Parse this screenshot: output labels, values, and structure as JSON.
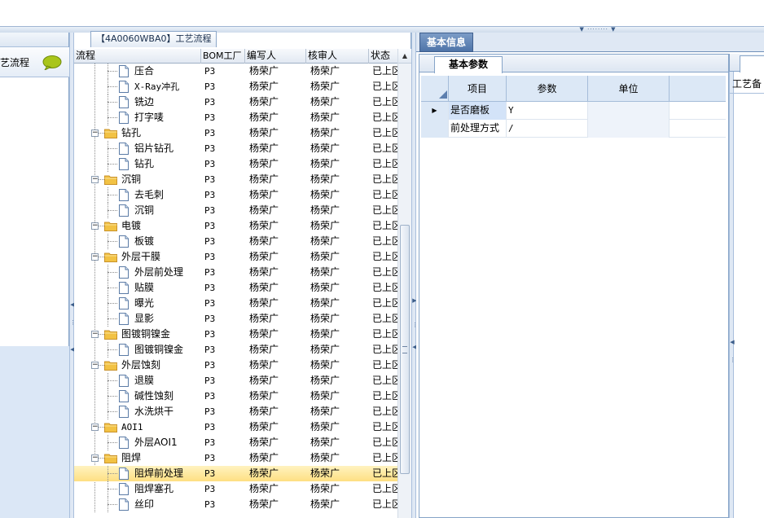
{
  "left_panel": {
    "tab_label": "艺流程"
  },
  "tree_panel": {
    "tab_title": "【4A0060WBA0】工艺流程",
    "columns": [
      "流程",
      "BOM工厂",
      "编写人",
      "核审人",
      "状态"
    ],
    "rows": [
      {
        "name": "压合",
        "level": 2,
        "bom": "P3",
        "writer": "杨荣广",
        "reviewer": "杨荣广",
        "status": "已上区"
      },
      {
        "name": "X-Ray冲孔",
        "level": 2,
        "bom": "P3",
        "writer": "杨荣广",
        "reviewer": "杨荣广",
        "status": "已上区"
      },
      {
        "name": "铣边",
        "level": 2,
        "bom": "P3",
        "writer": "杨荣广",
        "reviewer": "杨荣广",
        "status": "已上区"
      },
      {
        "name": "打字唛",
        "level": 2,
        "bom": "P3",
        "writer": "杨荣广",
        "reviewer": "杨荣广",
        "status": "已上区"
      },
      {
        "name": "钻孔",
        "level": 1,
        "bom": "P3",
        "writer": "杨荣广",
        "reviewer": "杨荣广",
        "status": "已上区"
      },
      {
        "name": "铝片钻孔",
        "level": 2,
        "bom": "P3",
        "writer": "杨荣广",
        "reviewer": "杨荣广",
        "status": "已上区"
      },
      {
        "name": "钻孔",
        "level": 2,
        "bom": "P3",
        "writer": "杨荣广",
        "reviewer": "杨荣广",
        "status": "已上区"
      },
      {
        "name": "沉铜",
        "level": 1,
        "bom": "P3",
        "writer": "杨荣广",
        "reviewer": "杨荣广",
        "status": "已上区"
      },
      {
        "name": "去毛刺",
        "level": 2,
        "bom": "P3",
        "writer": "杨荣广",
        "reviewer": "杨荣广",
        "status": "已上区"
      },
      {
        "name": "沉铜",
        "level": 2,
        "bom": "P3",
        "writer": "杨荣广",
        "reviewer": "杨荣广",
        "status": "已上区"
      },
      {
        "name": "电镀",
        "level": 1,
        "bom": "P3",
        "writer": "杨荣广",
        "reviewer": "杨荣广",
        "status": "已上区"
      },
      {
        "name": "板镀",
        "level": 2,
        "bom": "P3",
        "writer": "杨荣广",
        "reviewer": "杨荣广",
        "status": "已上区"
      },
      {
        "name": "外层干膜",
        "level": 1,
        "bom": "P3",
        "writer": "杨荣广",
        "reviewer": "杨荣广",
        "status": "已上区"
      },
      {
        "name": "外层前处理",
        "level": 2,
        "bom": "P3",
        "writer": "杨荣广",
        "reviewer": "杨荣广",
        "status": "已上区"
      },
      {
        "name": "贴膜",
        "level": 2,
        "bom": "P3",
        "writer": "杨荣广",
        "reviewer": "杨荣广",
        "status": "已上区"
      },
      {
        "name": "曝光",
        "level": 2,
        "bom": "P3",
        "writer": "杨荣广",
        "reviewer": "杨荣广",
        "status": "已上区"
      },
      {
        "name": "显影",
        "level": 2,
        "bom": "P3",
        "writer": "杨荣广",
        "reviewer": "杨荣广",
        "status": "已上区"
      },
      {
        "name": "图镀铜镍金",
        "level": 1,
        "bom": "P3",
        "writer": "杨荣广",
        "reviewer": "杨荣广",
        "status": "已上区"
      },
      {
        "name": "图镀铜镍金",
        "level": 2,
        "bom": "P3",
        "writer": "杨荣广",
        "reviewer": "杨荣广",
        "status": "已上区"
      },
      {
        "name": "外层蚀刻",
        "level": 1,
        "bom": "P3",
        "writer": "杨荣广",
        "reviewer": "杨荣广",
        "status": "已上区"
      },
      {
        "name": "退膜",
        "level": 2,
        "bom": "P3",
        "writer": "杨荣广",
        "reviewer": "杨荣广",
        "status": "已上区"
      },
      {
        "name": "碱性蚀刻",
        "level": 2,
        "bom": "P3",
        "writer": "杨荣广",
        "reviewer": "杨荣广",
        "status": "已上区"
      },
      {
        "name": "水洗烘干",
        "level": 2,
        "bom": "P3",
        "writer": "杨荣广",
        "reviewer": "杨荣广",
        "status": "已上区"
      },
      {
        "name": "AOI1",
        "level": 1,
        "bom": "P3",
        "writer": "杨荣广",
        "reviewer": "杨荣广",
        "status": "已上区"
      },
      {
        "name": "外层AOI1",
        "level": 2,
        "bom": "P3",
        "writer": "杨荣广",
        "reviewer": "杨荣广",
        "status": "已上区"
      },
      {
        "name": "阻焊",
        "level": 1,
        "bom": "P3",
        "writer": "杨荣广",
        "reviewer": "杨荣广",
        "status": "已上区"
      },
      {
        "name": "阻焊前处理",
        "level": 2,
        "bom": "P3",
        "writer": "杨荣广",
        "reviewer": "杨荣广",
        "status": "已上区",
        "selected": true
      },
      {
        "name": "阻焊塞孔",
        "level": 2,
        "bom": "P3",
        "writer": "杨荣广",
        "reviewer": "杨荣广",
        "status": "已上区"
      },
      {
        "name": "丝印",
        "level": 2,
        "bom": "P3",
        "writer": "杨荣广",
        "reviewer": "杨荣广",
        "status": "已上区"
      }
    ]
  },
  "info_panel": {
    "tab_label": "基本信息",
    "sub_tab_label": "基本参数",
    "columns": [
      "项目",
      "参数",
      "单位"
    ],
    "rows": [
      {
        "item": "是否磨板",
        "param": "Y",
        "unit": "",
        "current": true
      },
      {
        "item": "前处理方式",
        "param": "/",
        "unit": ""
      }
    ]
  },
  "right_edge": {
    "label": "工艺备"
  },
  "colors": {
    "selected_row": "#fedf82",
    "tab_active": "#4f74a8",
    "folder": "#f2c244"
  }
}
